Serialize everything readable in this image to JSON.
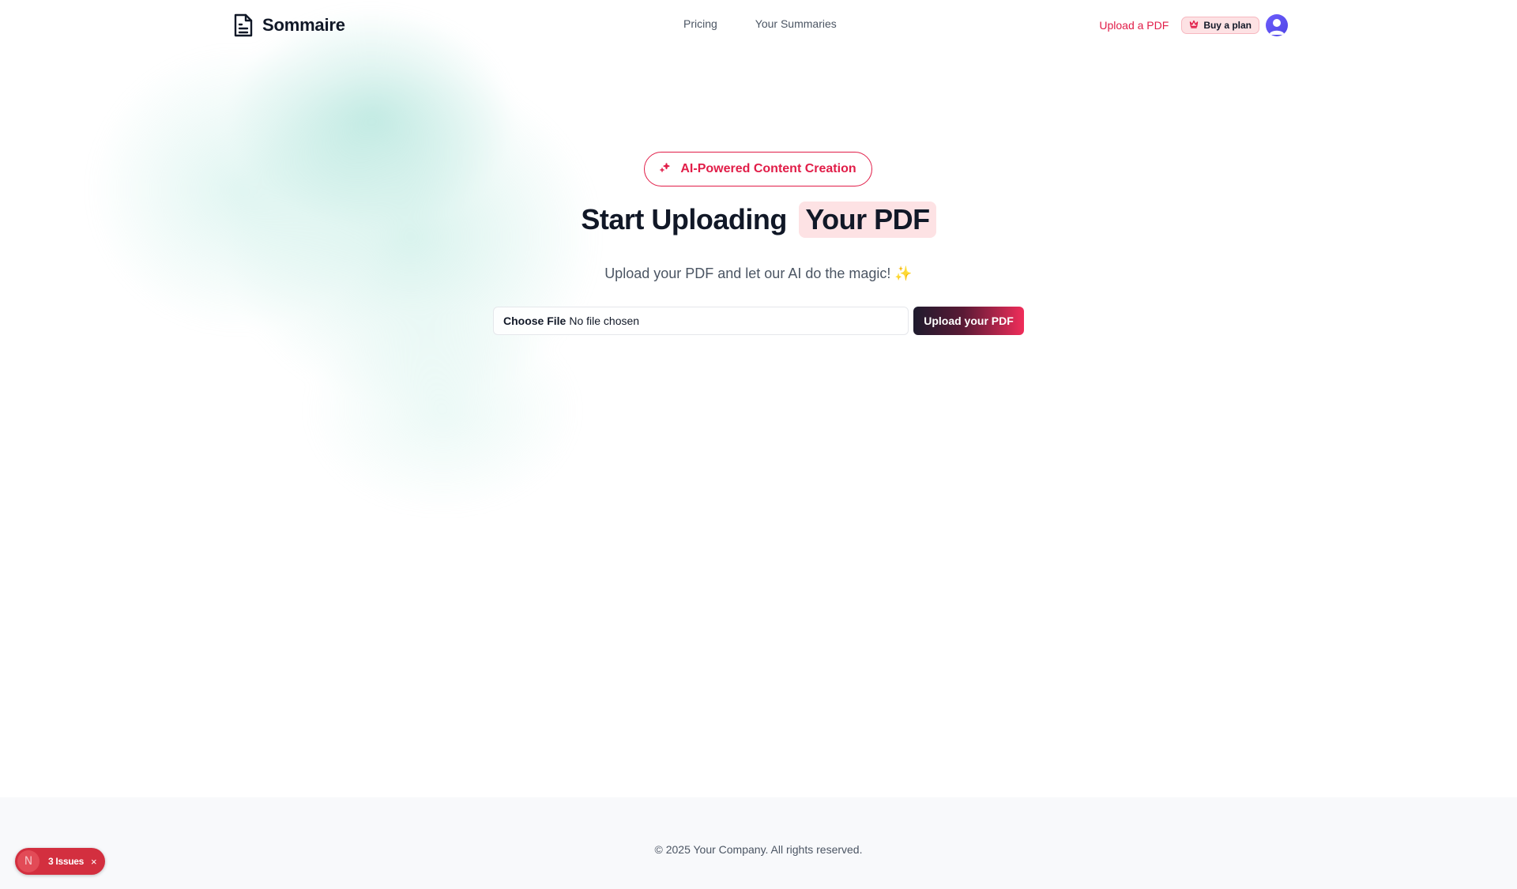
{
  "header": {
    "brand": "Sommaire",
    "nav": [
      {
        "label": "Pricing"
      },
      {
        "label": "Your Summaries"
      }
    ],
    "upload_link": "Upload a PDF",
    "plan_badge": "Buy a plan"
  },
  "hero": {
    "pill": "AI-Powered Content Creation",
    "headline_main": "Start Uploading",
    "headline_highlight": "Your PDF",
    "subtitle": "Upload your PDF and let our AI do the magic! ✨",
    "file_input": {
      "choose_label": "Choose File",
      "status": "No file chosen"
    },
    "upload_button": "Upload your PDF"
  },
  "footer": {
    "copyright": "© 2025 Your Company. All rights reserved."
  },
  "dev_overlay": {
    "logo_letter": "N",
    "issues_label": "3 Issues",
    "close_glyph": "×"
  },
  "colors": {
    "accent": "#e11d48",
    "text_dark": "#111827",
    "text_muted": "#4b5563",
    "highlight_bg": "#fde2e4",
    "issues_bg": "#d32f3f"
  },
  "icons": {
    "logo": "file-text-icon",
    "pill": "sparkles-icon",
    "plan": "crown-icon",
    "avatar": "user-avatar-icon"
  }
}
